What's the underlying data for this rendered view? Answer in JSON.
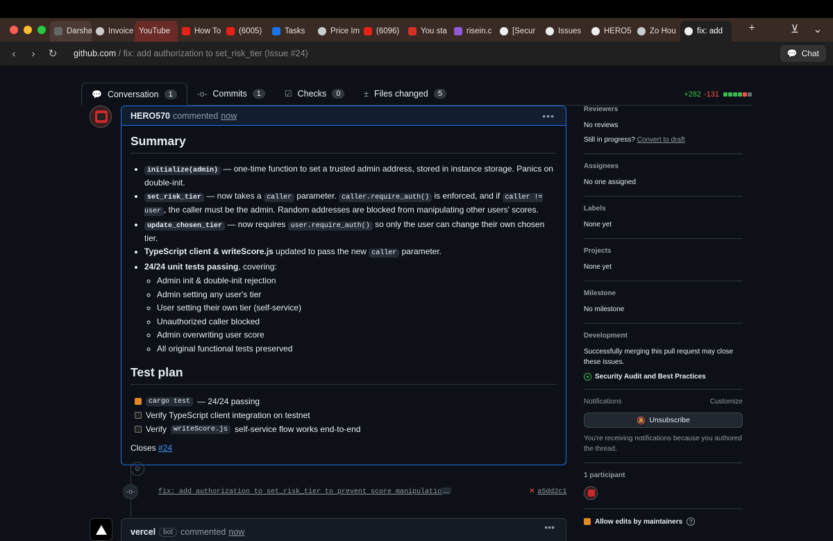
{
  "browser": {
    "tabs": [
      {
        "label": "Darshan",
        "icon": "profile-icon",
        "style": "grey"
      },
      {
        "label": "Invoice",
        "icon": "openai-icon",
        "style": ""
      },
      {
        "label": "YouTube",
        "icon": "",
        "style": "red"
      },
      {
        "label": "How To",
        "icon": "youtube-icon",
        "style": ""
      },
      {
        "label": "(6005)",
        "icon": "youtube-icon",
        "style": ""
      },
      {
        "label": "Tasks",
        "icon": "check-icon",
        "style": ""
      },
      {
        "label": "Price Im",
        "icon": "openai-icon",
        "style": ""
      },
      {
        "label": "(6096)",
        "icon": "youtube-icon",
        "style": ""
      },
      {
        "label": "You sta",
        "icon": "gmail-icon",
        "style": ""
      },
      {
        "label": "risein.c",
        "icon": "risein-icon",
        "style": ""
      },
      {
        "label": "[Secur",
        "icon": "github-icon",
        "style": ""
      },
      {
        "label": "Issues",
        "icon": "github-icon",
        "style": ""
      },
      {
        "label": "HERO5",
        "icon": "github-icon",
        "style": ""
      },
      {
        "label": "Zo Hou",
        "icon": "openai-icon",
        "style": ""
      },
      {
        "label": "fix: add",
        "icon": "github-icon",
        "style": "active"
      }
    ],
    "url_host": "github.com",
    "url_path": " / fix: add authorization to set_risk_tier (Issue #24)",
    "chat_label": "Chat"
  },
  "pr_tabs": [
    {
      "label": "Conversation",
      "count": "1",
      "icon": "comment-icon"
    },
    {
      "label": "Commits",
      "count": "1",
      "icon": "commit-icon"
    },
    {
      "label": "Checks",
      "count": "0",
      "icon": "checks-icon"
    },
    {
      "label": "Files changed",
      "count": "5",
      "icon": "file-diff-icon"
    }
  ],
  "diffstat": {
    "additions": "+282",
    "deletions": "-131",
    "colors": [
      "#3fb950",
      "#3fb950",
      "#3fb950",
      "#3fb950",
      "#f85149",
      "#656c76"
    ]
  },
  "comment": {
    "author": "HERO570",
    "action": "commented",
    "time": "now",
    "summary_heading": "Summary",
    "b1_code": "initialize(admin)",
    "b1_text": " — one-time function to set a trusted admin address, stored in instance storage. Panics on double-init.",
    "b2_code": "set_risk_tier",
    "b2_text1": " — now takes a ",
    "b2_code2": "caller",
    "b2_text2": " parameter. ",
    "b2_code3": "caller.require_auth()",
    "b2_text3": " is enforced, and if ",
    "b2_code4": "caller != user",
    "b2_text4": ", the caller must be the admin. Random addresses are blocked from manipulating other users' scores.",
    "b3_code": "update_chosen_tier",
    "b3_text1": " — now requires ",
    "b3_code2": "user.require_auth()",
    "b3_text2": " so only the user can change their own chosen tier.",
    "b4_bold": "TypeScript client & writeScore.js",
    "b4_text1": " updated to pass the new ",
    "b4_code": "caller",
    "b4_text2": " parameter.",
    "b5_bold": "24/24 unit tests passing",
    "b5_text": ", covering:",
    "sub_items": [
      "Admin init & double-init rejection",
      "Admin setting any user's tier",
      "User setting their own tier (self-service)",
      "Unauthorized caller blocked",
      "Admin overwriting user score",
      "All original functional tests preserved"
    ],
    "testplan_heading": "Test plan",
    "t1_code": "cargo test",
    "t1_text": " — 24/24 passing",
    "t2_text": "Verify TypeScript client integration on testnet",
    "t3_text1": "Verify ",
    "t3_code": "writeScore.js",
    "t3_text2": " self-service flow works end-to-end",
    "closes_text": "Closes ",
    "closes_link": "#24"
  },
  "commit": {
    "message": "fix: add authorization to set_risk_tier to prevent score manipulation",
    "more": "…",
    "sha": "a5dd2c1"
  },
  "vercel": {
    "author": "vercel",
    "badge": "bot",
    "action": "commented",
    "time": "now"
  },
  "sidebar": {
    "reviewers_title": "Reviewers",
    "reviewers_value": "No reviews",
    "still_text": "Still in progress?",
    "convert_link": "Convert to draft",
    "assignees_title": "Assignees",
    "assignees_value": "No one assigned",
    "labels_title": "Labels",
    "labels_value": "None yet",
    "projects_title": "Projects",
    "projects_value": "None yet",
    "milestone_title": "Milestone",
    "milestone_value": "No milestone",
    "development_title": "Development",
    "development_text": "Successfully merging this pull request may close these issues.",
    "development_issue": "Security Audit and Best Practices",
    "notifications_title": "Notifications",
    "customize_link": "Customize",
    "unsubscribe_label": "Unsubscribe",
    "notifications_reason": "You're receiving notifications because you authored the thread.",
    "participants_title": "1 participant",
    "allow_edits_label": "Allow edits by maintainers"
  }
}
